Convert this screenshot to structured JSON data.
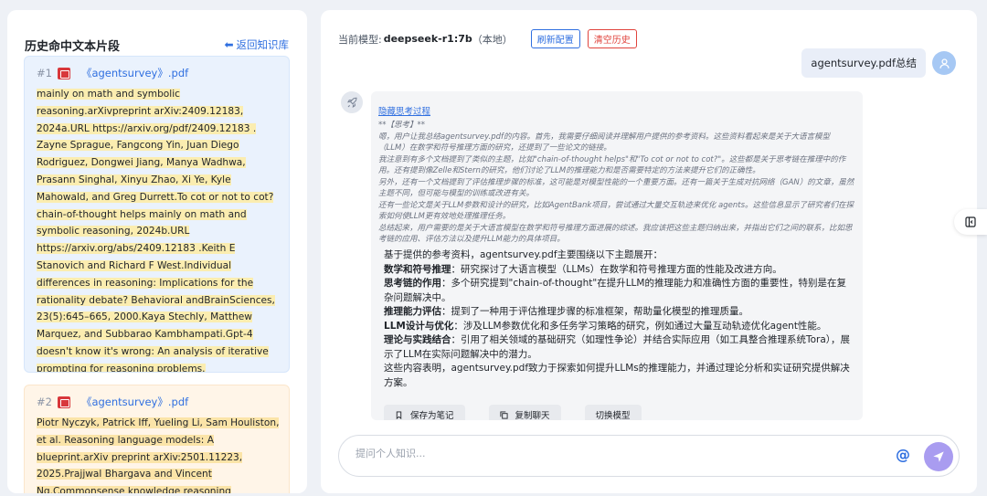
{
  "left": {
    "title": "历史命中文本片段",
    "back_label": "返回知识库",
    "cards": [
      {
        "index": "#1",
        "file": "《agentsurvey》.pdf",
        "text": " mainly on math and symbolic reasoning.arXivpreprint arXiv:2409.12183, 2024a.URL https://arxiv.org/pdf/2409.12183 . Zayne Sprague, Fangcong Yin, Juan Diego Rodriguez, Dongwei Jiang, Manya Wadhwa, Prasann Singhal, Xinyu Zhao, Xi Ye, Kyle Mahowald, and Greg Durrett.To cot or not to cot? chain-of-thought helps mainly on math and symbolic reasoning, 2024b.URL https://arxiv.org/abs/2409.12183 .Keith E Stanovich and Richard F West.Individual differences in reasoning: Implications for the rationality debate? Behavioral andBrainSciences, 23(5):645–665, 2000.Kaya Stechly, Matthew Marquez, and Subbarao Kambhampati.Gpt-4 doesn't know it's wrong: An analysis of iterative prompting for reasoning problems."
      },
      {
        "index": "#2",
        "file": "《agentsurvey》.pdf",
        "text": " Piotr Nyczyk, Patrick Iff, Yueling Li, Sam Houliston, et al. Reasoning language models: A blueprint.arXiv preprint arXiv:2501.11223, 2025.Prajjwal Bhargava and Vincent Ng.Commonsense knowledge reasoning"
      }
    ]
  },
  "header": {
    "model_prefix": "当前模型:",
    "model_name": "deepseek-r1:7b",
    "model_suffix": "（本地）",
    "refresh_label": "刷新配置",
    "clear_label": "清空历史"
  },
  "chat": {
    "user_message": "agentsurvey.pdf总结",
    "think_toggle": "隐藏思考过程",
    "think_lines": [
      "**【思考】**",
      "嗯，用户让我总结agentsurvey.pdf的内容。首先，我需要仔细阅读并理解用户提供的参考资料。这些资料看起来是关于大语言模型（LLM）在数学和符号推理方面的研究，还提到了一些论文的链接。",
      "我注意到有多个文档提到了类似的主题，比如\"chain-of-thought helps\"和\"To cot or not to cot?\"。这些都是关于思考链在推理中的作用。还有提到像Zelle和Stern的研究，他们讨论了LLM的推理能力和是否需要特定的方法来提升它们的正确性。",
      "另外，还有一个文档提到了评估推理步骤的标准，这可能是对模型性能的一个重要方面。还有一篇关于生成对抗网络（GAN）的文章，虽然主题不同，但可能与模型的训练或改进有关。",
      "还有一些论文是关于LLM参数和设计的研究，比如AgentBank项目，尝试通过大量交互轨迹来优化 agents。这些信息显示了研究者们在探索如何使LLM更有效地处理推理任务。",
      "总结起来，用户需要的是关于大语言模型在数学和符号推理方面进展的综述。我应该把这些主题归纳出来，并指出它们之间的联系，比如思考链的应用、评估方法以及提升LLM能力的具体项目。"
    ],
    "answer": {
      "intro": "基于提供的参考资料，agentsurvey.pdf主要围绕以下主题展开：",
      "points": [
        {
          "title": "数学和符号推理",
          "text": "：研究探讨了大语言模型（LLMs）在数学和符号推理方面的性能及改进方向。"
        },
        {
          "title": "思考链的作用",
          "text": "：多个研究提到\"chain-of-thought\"在提升LLM的推理能力和准确性方面的重要性，特别是在复杂问题解决中。"
        },
        {
          "title": "推理能力评估",
          "text": "：提到了一种用于评估推理步骤的标准框架，帮助量化模型的推理质量。"
        },
        {
          "title": "LLM设计与优化",
          "text": "：涉及LLM参数优化和多任务学习策略的研究，例如通过大量互动轨迹优化agent性能。"
        },
        {
          "title": "理论与实践结合",
          "text": "：引用了相关领域的基础研究（如理性争论）并结合实际应用（如工具整合推理系统Tora），展示了LLM在实际问题解决中的潜力。"
        }
      ],
      "conclusion": "这些内容表明，agentsurvey.pdf致力于探索如何提升LLMs的推理能力，并通过理论分析和实证研究提供解决方案。"
    },
    "actions": [
      "保存为笔记",
      "复制聊天",
      "切换模型"
    ]
  },
  "input": {
    "placeholder": "提问个人知识...",
    "at_symbol": "@"
  },
  "colors": {
    "accent": "#2f6fe0",
    "danger": "#e0433c",
    "send": "#a99cf0",
    "highlight": "#fbedb0"
  },
  "icons": [
    "arrow-left-icon",
    "pdf-icon",
    "user-icon",
    "rocket-icon",
    "bookmark-icon",
    "copy-icon",
    "at-icon",
    "send-icon",
    "sidebar-toggle-icon"
  ]
}
